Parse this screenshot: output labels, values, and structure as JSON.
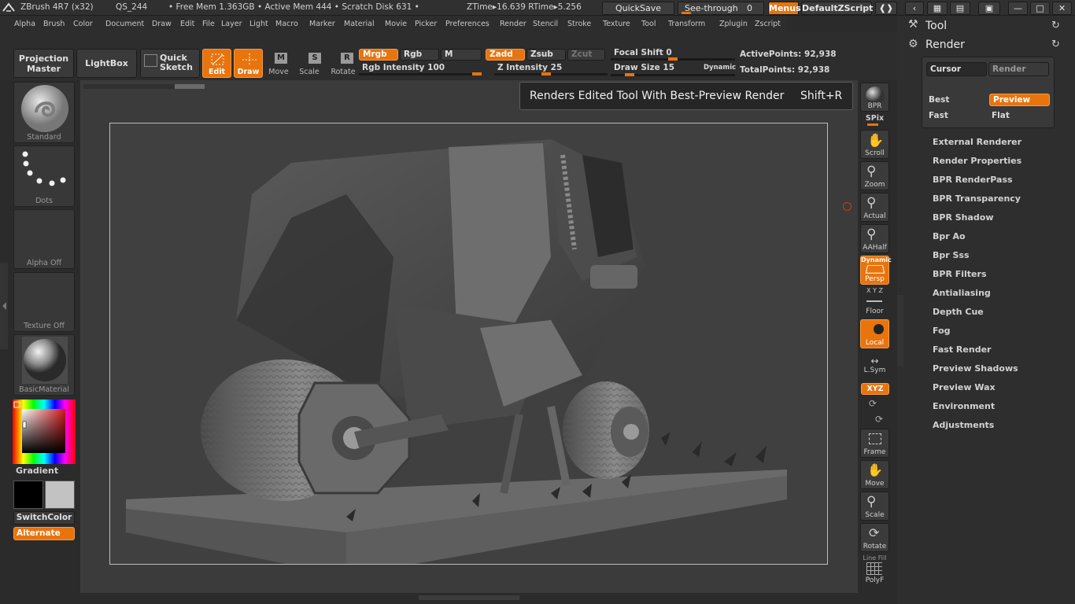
{
  "titlebar": {
    "app": "ZBrush 4R7 (x32)",
    "doc": "QS_244",
    "freemem": "• Free Mem 1.363GB • Active Mem 444 • Scratch Disk 631 •",
    "ztime": "ZTime▸16.639 RTime▸5.256",
    "quicksave": "QuickSave",
    "seethrough": "See-through",
    "seethrough_val": "0",
    "menus": "Menus",
    "script": "DefaultZScript"
  },
  "menubar": [
    "Alpha",
    "Brush",
    "Color",
    "Document",
    "Draw",
    "Edit",
    "File",
    "Layer",
    "Light",
    "Macro",
    "Marker",
    "Material",
    "Movie",
    "Picker",
    "Preferences",
    "Render",
    "Stencil",
    "Stroke",
    "Texture",
    "Tool",
    "Transform",
    "Zplugin",
    "Zscript"
  ],
  "toolbar": {
    "projection_master": [
      "Projection",
      "Master"
    ],
    "lightbox": "LightBox",
    "quick_sketch": [
      "Quick",
      "Sketch"
    ],
    "edit": "Edit",
    "draw": "Draw",
    "move": "Move",
    "scale": "Scale",
    "rotate": "Rotate",
    "mrgb": "Mrgb",
    "rgb": "Rgb",
    "m": "M",
    "rgb_intensity": "Rgb Intensity 100",
    "zadd": "Zadd",
    "zsub": "Zsub",
    "zcut": "Zcut",
    "z_intensity": "Z Intensity 25",
    "focal_shift": "Focal Shift 0",
    "draw_size": "Draw Size 15",
    "dynamic": "Dynamic",
    "active_points": "ActivePoints: 92,938",
    "total_points": "TotalPoints: 92,938",
    "rgb_intensity_level": 1.0,
    "z_intensity_level": 0.25,
    "focal_shift_level": 0.5,
    "draw_size_level": 0.1
  },
  "left_shelf": {
    "brush": "Standard",
    "stroke": "Dots",
    "alpha": "Alpha  Off",
    "texture": "Texture  Off",
    "material": "BasicMaterial",
    "gradient": "Gradient",
    "switchcolor": "SwitchColor",
    "alternate": "Alternate"
  },
  "tooltip": {
    "text": "Renders Edited Tool With Best-Preview Render",
    "shortcut": "Shift+R"
  },
  "right_shelf": {
    "bpr": "BPR",
    "spix": "SPix",
    "scroll": "Scroll",
    "zoom": "Zoom",
    "actual": "Actual",
    "aahalf": "AAHalf",
    "dynamic": "Dynamic",
    "persp": "Persp",
    "floor": "Floor",
    "xyz_axes": "X Y Z",
    "local": "Local",
    "lsym": "L.Sym",
    "xyz": "XYZ",
    "frame": "Frame",
    "move": "Move",
    "scale": "Scale",
    "rotate": "Rotate",
    "polyf": "PolyF",
    "linefill": "Line Fill"
  },
  "palette": {
    "tool": "Tool",
    "render": "Render",
    "cursor": "Cursor",
    "render_btn": "Render",
    "best": "Best",
    "preview": "Preview",
    "fast": "Fast",
    "flat": "Flat",
    "items": [
      "External Renderer",
      "Render Properties",
      "BPR RenderPass",
      "BPR Transparency",
      "BPR Shadow",
      "Bpr Ao",
      "Bpr Sss",
      "BPR Filters",
      "Antialiasing",
      "Depth Cue",
      "Fog",
      "Fast Render",
      "Preview Shadows",
      "Preview Wax",
      "Environment",
      "Adjustments"
    ]
  },
  "colors": {
    "accent": "#e8740e",
    "panel": "#2e2e2e",
    "canvas": "#3b3b3b"
  }
}
